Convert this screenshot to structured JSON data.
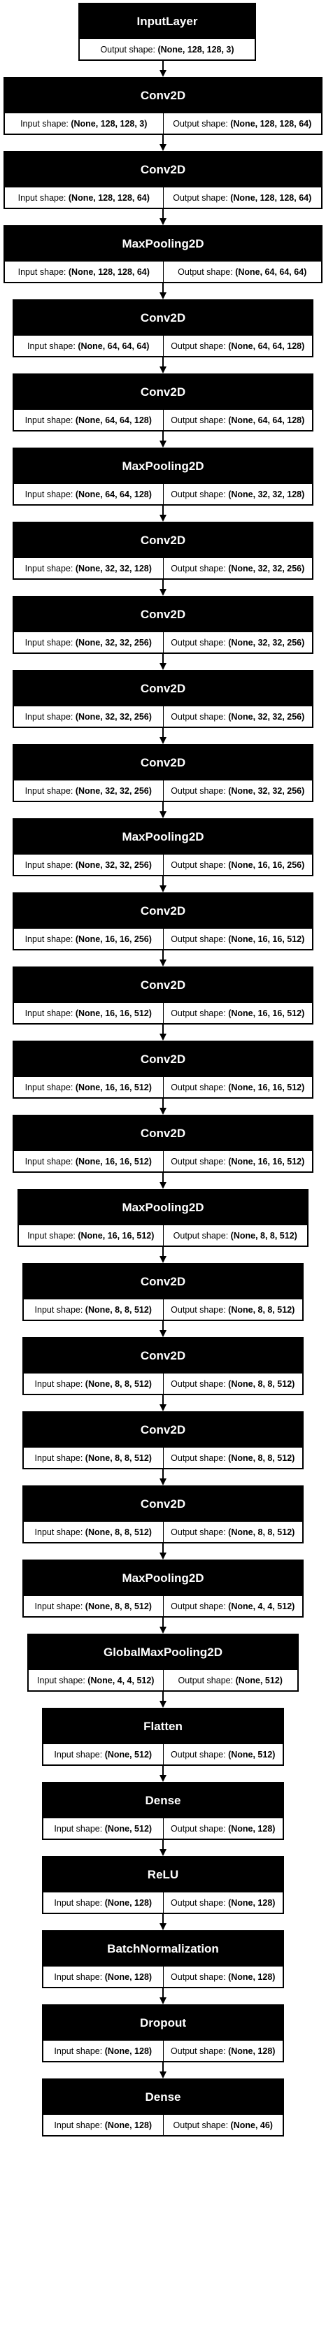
{
  "layers": [
    {
      "type": "InputLayer",
      "output_shape": "(None, 128, 128, 3)"
    },
    {
      "type": "Conv2D",
      "input_shape": "(None, 128, 128, 3)",
      "output_shape": "(None, 128, 128, 64)"
    },
    {
      "type": "Conv2D",
      "input_shape": "(None, 128, 128, 64)",
      "output_shape": "(None, 128, 128, 64)"
    },
    {
      "type": "MaxPooling2D",
      "input_shape": "(None, 128, 128, 64)",
      "output_shape": "(None, 64, 64, 64)"
    },
    {
      "type": "Conv2D",
      "input_shape": "(None, 64, 64, 64)",
      "output_shape": "(None, 64, 64, 128)"
    },
    {
      "type": "Conv2D",
      "input_shape": "(None, 64, 64, 128)",
      "output_shape": "(None, 64, 64, 128)"
    },
    {
      "type": "MaxPooling2D",
      "input_shape": "(None, 64, 64, 128)",
      "output_shape": "(None, 32, 32, 128)"
    },
    {
      "type": "Conv2D",
      "input_shape": "(None, 32, 32, 128)",
      "output_shape": "(None, 32, 32, 256)"
    },
    {
      "type": "Conv2D",
      "input_shape": "(None, 32, 32, 256)",
      "output_shape": "(None, 32, 32, 256)"
    },
    {
      "type": "Conv2D",
      "input_shape": "(None, 32, 32, 256)",
      "output_shape": "(None, 32, 32, 256)"
    },
    {
      "type": "Conv2D",
      "input_shape": "(None, 32, 32, 256)",
      "output_shape": "(None, 32, 32, 256)"
    },
    {
      "type": "MaxPooling2D",
      "input_shape": "(None, 32, 32, 256)",
      "output_shape": "(None, 16, 16, 256)"
    },
    {
      "type": "Conv2D",
      "input_shape": "(None, 16, 16, 256)",
      "output_shape": "(None, 16, 16, 512)"
    },
    {
      "type": "Conv2D",
      "input_shape": "(None, 16, 16, 512)",
      "output_shape": "(None, 16, 16, 512)"
    },
    {
      "type": "Conv2D",
      "input_shape": "(None, 16, 16, 512)",
      "output_shape": "(None, 16, 16, 512)"
    },
    {
      "type": "Conv2D",
      "input_shape": "(None, 16, 16, 512)",
      "output_shape": "(None, 16, 16, 512)"
    },
    {
      "type": "MaxPooling2D",
      "input_shape": "(None, 16, 16, 512)",
      "output_shape": "(None, 8, 8, 512)"
    },
    {
      "type": "Conv2D",
      "input_shape": "(None, 8, 8, 512)",
      "output_shape": "(None, 8, 8, 512)"
    },
    {
      "type": "Conv2D",
      "input_shape": "(None, 8, 8, 512)",
      "output_shape": "(None, 8, 8, 512)"
    },
    {
      "type": "Conv2D",
      "input_shape": "(None, 8, 8, 512)",
      "output_shape": "(None, 8, 8, 512)"
    },
    {
      "type": "Conv2D",
      "input_shape": "(None, 8, 8, 512)",
      "output_shape": "(None, 8, 8, 512)"
    },
    {
      "type": "MaxPooling2D",
      "input_shape": "(None, 8, 8, 512)",
      "output_shape": "(None, 4, 4, 512)"
    },
    {
      "type": "GlobalMaxPooling2D",
      "input_shape": "(None, 4, 4, 512)",
      "output_shape": "(None, 512)"
    },
    {
      "type": "Flatten",
      "input_shape": "(None, 512)",
      "output_shape": "(None, 512)"
    },
    {
      "type": "Dense",
      "input_shape": "(None, 512)",
      "output_shape": "(None, 128)"
    },
    {
      "type": "ReLU",
      "input_shape": "(None, 128)",
      "output_shape": "(None, 128)"
    },
    {
      "type": "BatchNormalization",
      "input_shape": "(None, 128)",
      "output_shape": "(None, 128)"
    },
    {
      "type": "Dropout",
      "input_shape": "(None, 128)",
      "output_shape": "(None, 128)"
    },
    {
      "type": "Dense",
      "input_shape": "(None, 128)",
      "output_shape": "(None, 46)"
    }
  ],
  "labels": {
    "input_shape": "Input shape:",
    "output_shape": "Output shape:"
  },
  "colors": {
    "header_bg": "#000000",
    "header_text": "#ffffff",
    "border": "#000000",
    "background": "#ffffff"
  }
}
